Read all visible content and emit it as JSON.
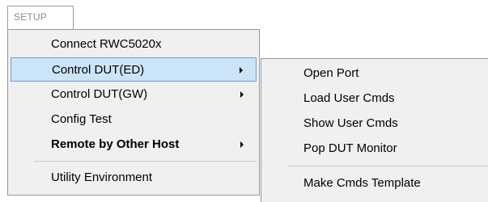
{
  "menubar": {
    "tab_label": "SETUP"
  },
  "main_menu": {
    "items": [
      {
        "label": "Connect RWC5020x",
        "submenu": false
      },
      {
        "label": "Control DUT(ED)",
        "submenu": true,
        "highlighted": true
      },
      {
        "label": "Control DUT(GW)",
        "submenu": true
      },
      {
        "label": "Config Test",
        "submenu": false
      },
      {
        "label": "Remote by Other Host",
        "submenu": true,
        "bold": true
      },
      {
        "label": "Utility Environment",
        "submenu": false
      }
    ]
  },
  "submenu": {
    "items": [
      {
        "label": "Open Port"
      },
      {
        "label": "Load User Cmds"
      },
      {
        "label": "Show User Cmds"
      },
      {
        "label": "Pop DUT Monitor"
      },
      {
        "label": "Make Cmds Template"
      }
    ]
  },
  "colors": {
    "highlight_fill": "#cce4f7",
    "highlight_border": "#6a9fd8",
    "menu_bg": "#f0f0f0"
  }
}
